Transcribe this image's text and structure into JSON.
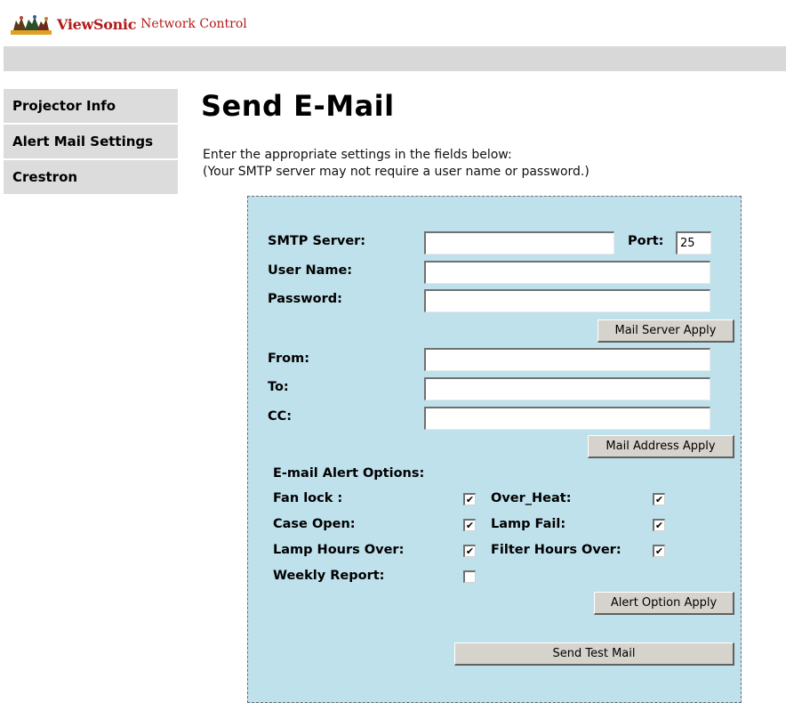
{
  "brand": {
    "name": "ViewSonic",
    "product": "Network Control"
  },
  "nav": {
    "items": [
      {
        "label": "Projector Info"
      },
      {
        "label": "Alert Mail Settings"
      },
      {
        "label": "Crestron"
      }
    ]
  },
  "page": {
    "title": "Send E-Mail",
    "desc_line1": "Enter the appropriate settings in the fields below:",
    "desc_line2": "(Your SMTP server may not require a user name or password.)"
  },
  "server": {
    "smtp_label": "SMTP Server:",
    "smtp_value": "",
    "port_label": "Port:",
    "port_value": "25",
    "user_label": "User Name:",
    "user_value": "",
    "password_label": "Password:",
    "password_value": "",
    "apply_label": "Mail Server Apply"
  },
  "address": {
    "from_label": "From:",
    "from_value": "",
    "to_label": "To:",
    "to_value": "",
    "cc_label": "CC:",
    "cc_value": "",
    "apply_label": "Mail Address Apply"
  },
  "alerts": {
    "heading": "E-mail Alert Options:",
    "fan_lock": {
      "label": "Fan lock :",
      "checked": true
    },
    "case_open": {
      "label": "Case Open:",
      "checked": true
    },
    "lamp_hours_over": {
      "label": "Lamp Hours Over:",
      "checked": true
    },
    "weekly_report": {
      "label": "Weekly Report:",
      "checked": false
    },
    "over_heat": {
      "label": "Over_Heat:",
      "checked": true
    },
    "lamp_fail": {
      "label": "Lamp Fail:",
      "checked": true
    },
    "filter_hours_over": {
      "label": "Filter Hours Over:",
      "checked": true
    },
    "apply_label": "Alert Option Apply"
  },
  "test": {
    "send_label": "Send Test Mail"
  },
  "colors": {
    "brand_red": "#b21a1a",
    "panel_bg": "#bfe1ec",
    "nav_bg": "#dcdcdc",
    "topbar": "#d8d8d8"
  }
}
